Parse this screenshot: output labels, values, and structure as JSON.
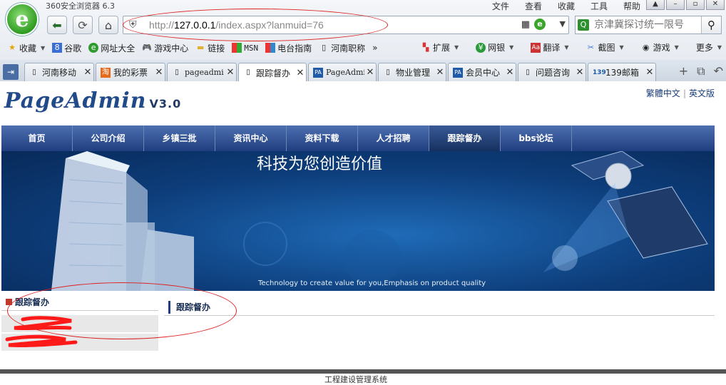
{
  "browser": {
    "title": "360安全浏览器 6.3",
    "menu": [
      "文件",
      "查看",
      "收藏",
      "工具",
      "帮助"
    ],
    "url_host": "127.0.0.1",
    "url_rest": "/index.aspx?lanmuid=76",
    "search_placeholder": "京津冀探讨统一限号",
    "favorites": [
      {
        "label": "收藏",
        "icon": "star-icon",
        "caret": true
      },
      {
        "label": "谷歌",
        "icon": "google-icon"
      },
      {
        "label": "网址大全",
        "icon": "web-directory-icon"
      },
      {
        "label": "游戏中心",
        "icon": "gamepad-icon"
      },
      {
        "label": "链接",
        "icon": "folder-icon"
      },
      {
        "label": "MSN",
        "icon": "msn-icon"
      },
      {
        "label": "电台指南",
        "icon": "radio-icon"
      },
      {
        "label": "河南职称",
        "icon": "page-icon"
      }
    ],
    "favorites_more": "»",
    "toolbar_right": [
      {
        "label": "扩展",
        "icon": "extension-icon"
      },
      {
        "label": "网银",
        "icon": "bank-icon"
      },
      {
        "label": "翻译",
        "icon": "translate-icon"
      },
      {
        "label": "截图",
        "icon": "screenshot-icon"
      },
      {
        "label": "游戏",
        "icon": "game-icon"
      },
      {
        "label": "更多",
        "icon": ""
      }
    ],
    "tabs": [
      {
        "label": "河南移动",
        "icon": "page-icon"
      },
      {
        "label": "我的彩票",
        "icon": "lottery-icon"
      },
      {
        "label": "pageadmi",
        "icon": "page-icon"
      },
      {
        "label": "跟踪督办",
        "icon": "page-icon",
        "active": true
      },
      {
        "label": "PageAdmi",
        "icon": "pa-icon"
      },
      {
        "label": "物业管理",
        "icon": "page-icon"
      },
      {
        "label": "会员中心",
        "icon": "pa-icon"
      },
      {
        "label": "问题咨询",
        "icon": "page-icon"
      },
      {
        "label": "139邮箱",
        "icon": "mail139-icon"
      }
    ]
  },
  "site": {
    "brand": "PageAdmin",
    "version": "V3.0",
    "lang_trad": "繁體中文",
    "lang_en": "英文版",
    "nav": [
      {
        "label": "首页"
      },
      {
        "label": "公司介绍"
      },
      {
        "label": "乡镇三批"
      },
      {
        "label": "资讯中心"
      },
      {
        "label": "资料下载"
      },
      {
        "label": "人才招聘"
      },
      {
        "label": "跟踪督办",
        "active": true
      },
      {
        "label": "bbs论坛"
      }
    ],
    "banner_slogan": "科技为您创造价值",
    "banner_sub": "Technology to create value for you,Emphasis on product quality",
    "sidebar_title": "跟踪督办",
    "main_title": "跟踪督办",
    "footer_text": "工程建设管理系统"
  },
  "colors": {
    "nav_bg": "#2a4c8f",
    "annotation": "#dd2222",
    "scribble": "#ff0000"
  }
}
